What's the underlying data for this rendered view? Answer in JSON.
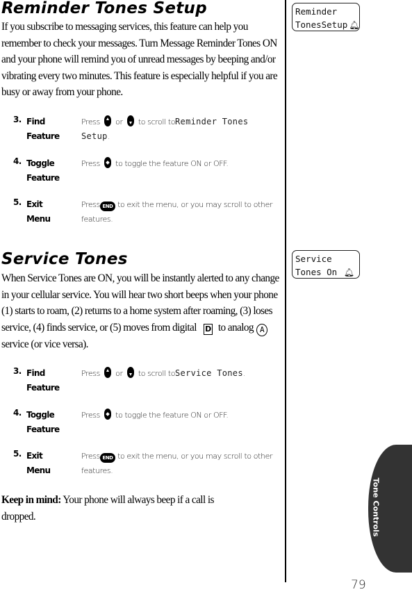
{
  "sections": [
    {
      "title": "Reminder Tones Setup",
      "body": "If you subscribe to messaging services, this feature can help you remember to check your messages. Turn Message Reminder Tones ON and your phone will remind you of unread messages by beeping and/or vibrating every two minutes. This feature is especially helpful if you are busy or away from your phone.",
      "display": {
        "line1": "Reminder",
        "line2": "TonesSetup",
        "icon": "bell-icon"
      },
      "steps": [
        {
          "num": "3.",
          "label1": "Find",
          "label2": "Feature",
          "press": "Press",
          "or": "or",
          "to_scroll": "to scroll to",
          "target": "Reminder Tones Setup",
          "end": "."
        },
        {
          "num": "4.",
          "label1": "Toggle",
          "label2": "Feature",
          "press": "Press",
          "text": "to toggle the feature ON or OFF."
        },
        {
          "num": "5.",
          "label1": "Exit",
          "label2": "Menu",
          "press": "Press",
          "key": "END",
          "text": "to exit the menu, or you may scroll to other features."
        }
      ]
    },
    {
      "title": "Service Tones",
      "body_part1": "When Service Tones are ON, you will be instantly alerted to any change in your cellular service. You will hear two short beeps when your phone (1) starts to roam, (2) returns to a home system after roaming, (3) loses service, (4) finds service, or (5) moves from digital",
      "digital_icon": "D",
      "body_part2": "to analog",
      "analog_icon": "A",
      "body_part3": "service (or vice versa).",
      "display": {
        "line1": "Service",
        "line2": "Tones On",
        "icon": "bell-icon"
      },
      "steps": [
        {
          "num": "3.",
          "label1": "Find",
          "label2": "Feature",
          "press": "Press",
          "or": "or",
          "to_scroll": "to scroll to",
          "target": "Service Tones",
          "end": "."
        },
        {
          "num": "4.",
          "label1": "Toggle",
          "label2": "Feature",
          "press": "Press",
          "text": "to toggle the feature ON or OFF."
        },
        {
          "num": "5.",
          "label1": "Exit",
          "label2": "Menu",
          "press": "Press",
          "key": "END",
          "text": "to exit the menu, or you may scroll to other features."
        }
      ]
    }
  ],
  "note": {
    "label": "Keep in mind:",
    "text": "Your phone will always beep if a call is dropped."
  },
  "side_tab": {
    "label": "Tone Controls",
    "color": "#333333"
  },
  "page_number": "79"
}
